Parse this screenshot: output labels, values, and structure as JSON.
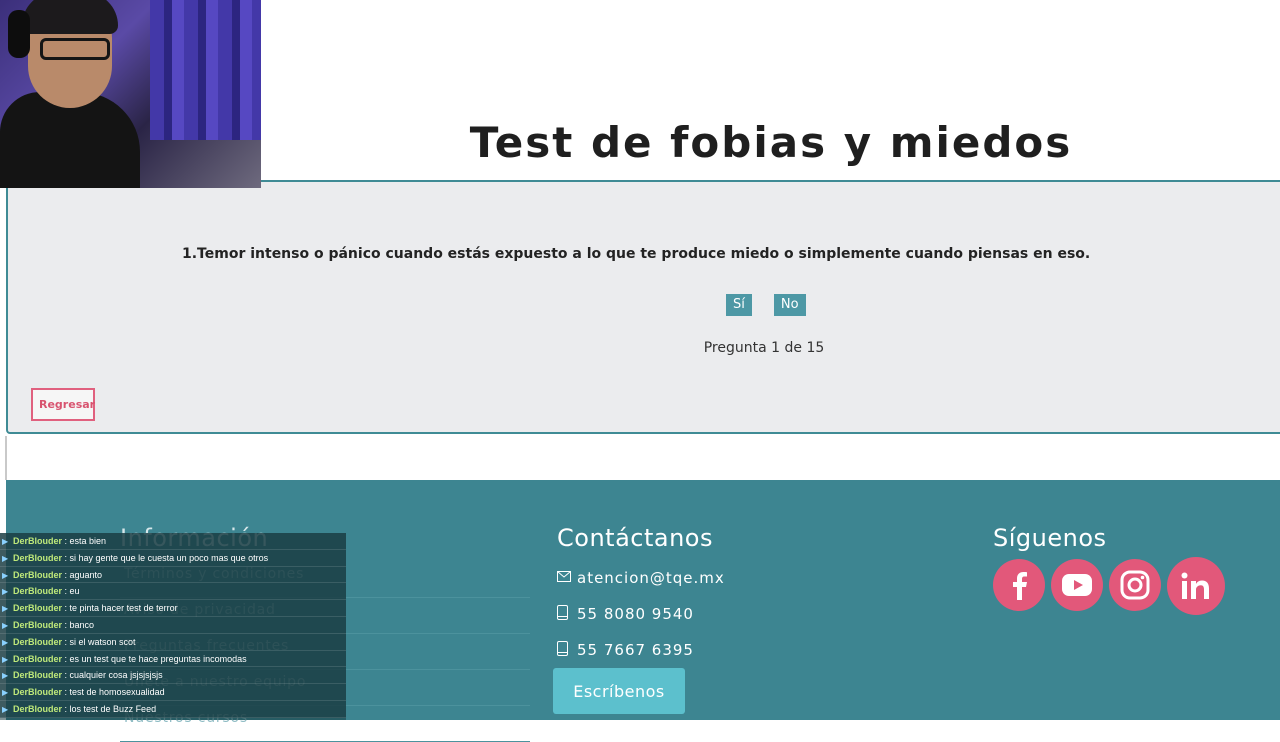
{
  "page": {
    "title": "Test de fobias y miedos"
  },
  "quiz": {
    "question": "1.Temor intenso o pánico cuando estás expuesto a lo que te produce miedo o simplemente cuando piensas en eso.",
    "yes_label": "Sí",
    "no_label": "No",
    "counter": "Pregunta 1 de 15",
    "back_label": "Regresar"
  },
  "footer": {
    "info": {
      "title": "Información",
      "links": [
        "Términos y condiciones",
        "Aviso de privacidad",
        "Preguntas frecuentes",
        "Únete a nuestro equipo",
        "Nuestros cursos"
      ]
    },
    "contact": {
      "title": "Contáctanos",
      "email": "atencion@tqe.mx",
      "phone1": "55 8080 9540",
      "phone2": "55 7667 6395",
      "button": "Escríbenos"
    },
    "follow": {
      "title": "Síguenos",
      "icons": [
        "facebook-icon",
        "youtube-icon",
        "instagram-icon",
        "linkedin-icon"
      ]
    }
  },
  "chat": {
    "messages": [
      {
        "user": "DerBlouder",
        "text": ": esta bien"
      },
      {
        "user": "DerBlouder",
        "text": ": si hay gente que le cuesta un poco mas que otros"
      },
      {
        "user": "DerBlouder",
        "text": ": aguanto"
      },
      {
        "user": "DerBlouder",
        "text": ": eu"
      },
      {
        "user": "DerBlouder",
        "text": ": te pinta hacer test de terror"
      },
      {
        "user": "DerBlouder",
        "text": ": banco"
      },
      {
        "user": "DerBlouder",
        "text": ": si el watson scot"
      },
      {
        "user": "DerBlouder",
        "text": ": es un test que te hace preguntas incomodas"
      },
      {
        "user": "DerBlouder",
        "text": ": cualquier cosa jsjsjsjsjs"
      },
      {
        "user": "DerBlouder",
        "text": ": test de homosexualidad"
      },
      {
        "user": "DerBlouder",
        "text": ": los test de Buzz Feed"
      }
    ]
  },
  "colors": {
    "accent": "#4d98a5",
    "footer_bg": "#3d8591",
    "panel_border": "#3f8b95",
    "social": "#e2587a",
    "back_button": "#e0607e",
    "write_button": "#5cc0cd"
  }
}
